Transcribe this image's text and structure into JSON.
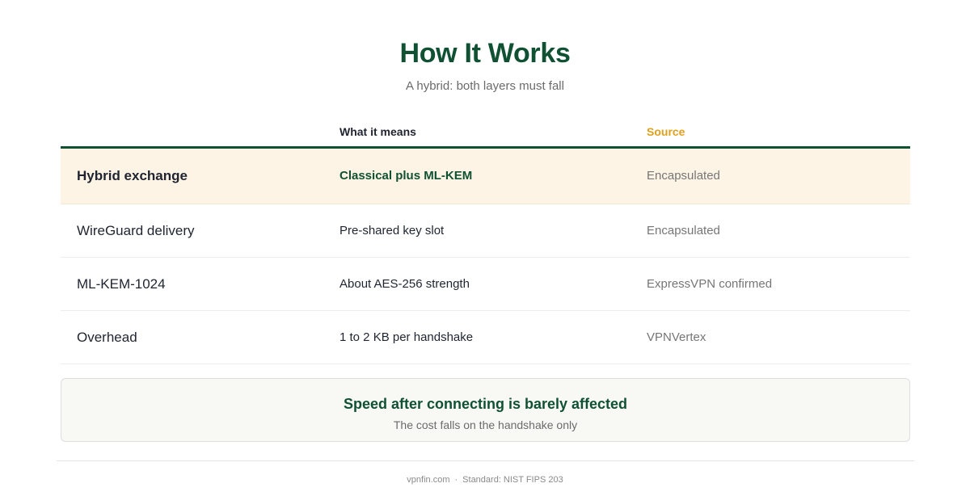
{
  "header": {
    "title": "How It Works",
    "subtitle": "A hybrid: both layers must fall"
  },
  "table": {
    "columns": [
      "",
      "What it means",
      "Source"
    ],
    "rows": [
      {
        "name": "Hybrid exchange",
        "meaning": "Classical plus ML-KEM",
        "source": "Encapsulated",
        "highlighted": true
      },
      {
        "name": "WireGuard delivery",
        "meaning": "Pre-shared key slot",
        "source": "Encapsulated",
        "highlighted": false
      },
      {
        "name": "ML-KEM-1024",
        "meaning": "About AES-256 strength",
        "source": "ExpressVPN confirmed",
        "highlighted": false
      },
      {
        "name": "Overhead",
        "meaning": "1 to 2 KB per handshake",
        "source": "VPNVertex",
        "highlighted": false
      }
    ]
  },
  "callout": {
    "title": "Speed after connecting is barely affected",
    "subtitle": "The cost falls on the handshake only"
  },
  "footer": {
    "site": "vpnfin.com",
    "separator": "·",
    "standard": "Standard: NIST FIPS 203"
  },
  "colors": {
    "accent_green": "#0f5132",
    "accent_orange": "#e0a01a",
    "highlight_row": "#fdf4e6"
  }
}
